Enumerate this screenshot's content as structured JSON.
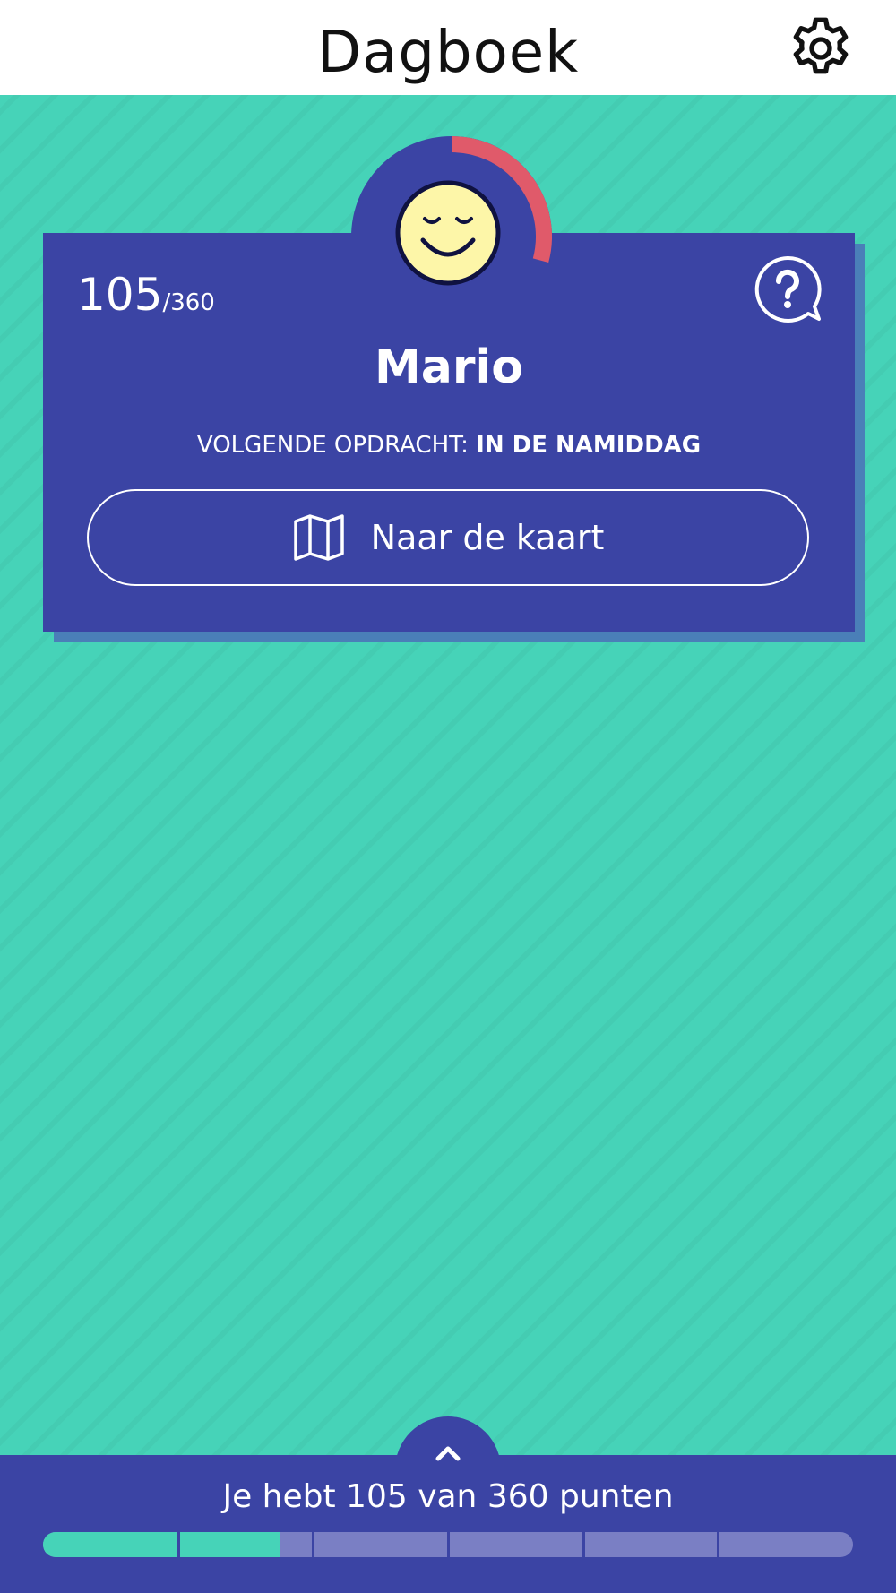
{
  "header": {
    "title": "Dagboek",
    "settings_icon": "gear-icon"
  },
  "colors": {
    "background": "#46d3b8",
    "card": "#3b44a4",
    "card_shadow": "#4a7fb8",
    "accent_ring": "#e05a6a",
    "face": "#fdf6a8",
    "progress_empty": "#7a7fc4"
  },
  "card": {
    "score": "105",
    "score_total": "/360",
    "help_icon": "question-bubble-icon",
    "name": "Mario",
    "next_task_prefix": "VOLGENDE OPDRACHT: ",
    "next_task_value": "IN DE NAMIDDAG",
    "map_button_label": "Naar de kaart",
    "map_icon": "map-icon",
    "avatar_icon": "smiling-face-icon",
    "avatar_progress": 0.2917
  },
  "bottom": {
    "expand_icon": "chevron-up-icon",
    "summary": "Je hebt 105 van 360 punten",
    "progress_value": 105,
    "progress_max": 360,
    "progress_segments": 6
  }
}
